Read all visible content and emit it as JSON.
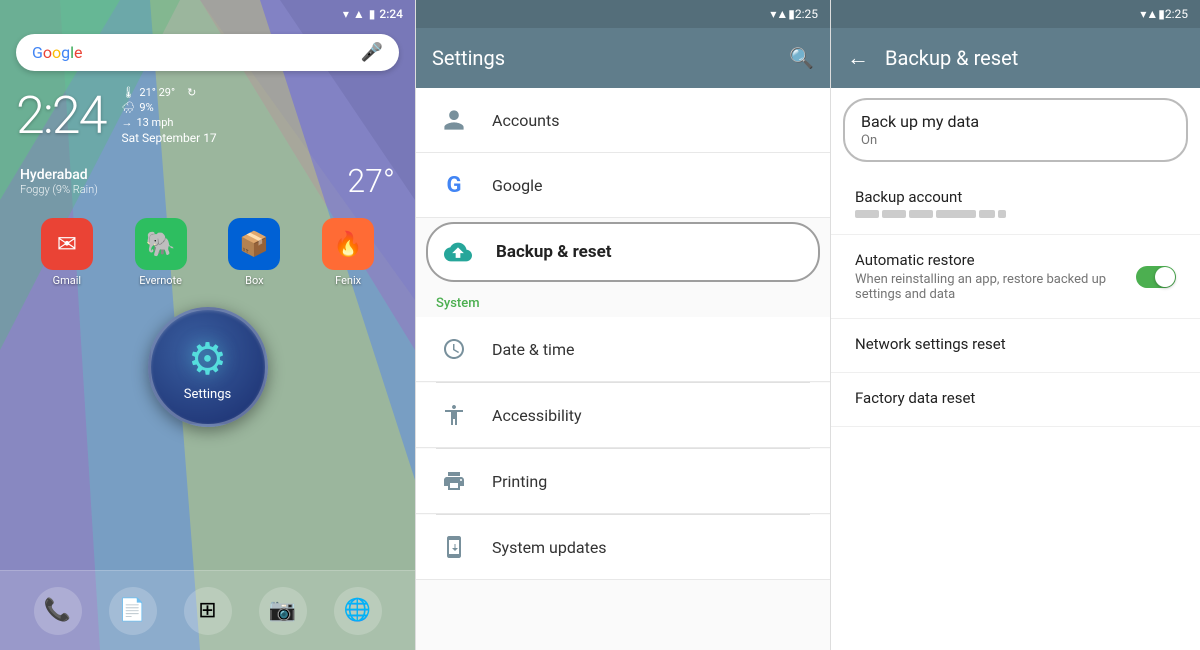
{
  "screen1": {
    "status_bar": {
      "time": "2:24",
      "icons": "wifi signal battery"
    },
    "search": {
      "google_text": "Google",
      "mic_hint": "microphone"
    },
    "clock": {
      "time": "2:24",
      "date": "Sat September 17"
    },
    "weather_details": {
      "temp_range": "21° 29°",
      "rain": "9%",
      "wind": "→ 13 mph"
    },
    "city": {
      "name": "Hyderabad",
      "condition": "Foggy (9% Rain)",
      "temp": "27°"
    },
    "apps": [
      {
        "name": "Gmail",
        "bg": "#EA4335",
        "icon": "✉"
      },
      {
        "name": "Evernote",
        "bg": "#2DBE60",
        "icon": "🐘"
      },
      {
        "name": "Box",
        "bg": "#0061D5",
        "icon": "📦"
      },
      {
        "name": "Fenix",
        "bg": "#FF6B35",
        "icon": "🔥"
      }
    ],
    "settings": {
      "label": "Settings",
      "icon": "⚙"
    },
    "dock": [
      {
        "icon": "📞",
        "name": "phone"
      },
      {
        "icon": "📄",
        "name": "notes"
      },
      {
        "icon": "⬛",
        "name": "apps"
      },
      {
        "icon": "📷",
        "name": "camera"
      },
      {
        "icon": "🌐",
        "name": "chrome"
      }
    ]
  },
  "screen2": {
    "status_bar": {
      "time": "2:25"
    },
    "header": {
      "title": "Settings",
      "search_icon": "🔍"
    },
    "items": [
      {
        "id": "accounts",
        "label": "Accounts",
        "icon": "👤",
        "color": "#78909C"
      },
      {
        "id": "google",
        "label": "Google",
        "icon": "G",
        "color": "#4285F4"
      },
      {
        "id": "backup",
        "label": "Backup & reset",
        "icon": "☁",
        "color": "#26A69A",
        "selected": true
      }
    ],
    "section_system": "System",
    "system_items": [
      {
        "id": "datetime",
        "label": "Date & time",
        "icon": "🕐",
        "color": "#78909C"
      },
      {
        "id": "accessibility",
        "label": "Accessibility",
        "icon": "♿",
        "color": "#78909C"
      },
      {
        "id": "printing",
        "label": "Printing",
        "icon": "🖨",
        "color": "#78909C"
      },
      {
        "id": "system_updates",
        "label": "System updates",
        "icon": "📱",
        "color": "#78909C"
      }
    ]
  },
  "screen3": {
    "status_bar": {
      "time": "2:25"
    },
    "header": {
      "title": "Backup & reset",
      "back": "←"
    },
    "items": [
      {
        "id": "back_up_my_data",
        "title": "Back up my data",
        "subtitle": "On",
        "highlighted": true,
        "has_toggle": false
      },
      {
        "id": "backup_account",
        "title": "Backup account",
        "has_dots": true,
        "highlighted": false
      },
      {
        "id": "automatic_restore",
        "title": "Automatic restore",
        "subtitle": "When reinstalling an app, restore backed up settings and data",
        "has_toggle": true,
        "toggle_on": true,
        "highlighted": false
      },
      {
        "id": "network_settings_reset",
        "title": "Network settings reset",
        "highlighted": false
      },
      {
        "id": "factory_data_reset",
        "title": "Factory data reset",
        "highlighted": false
      }
    ]
  }
}
